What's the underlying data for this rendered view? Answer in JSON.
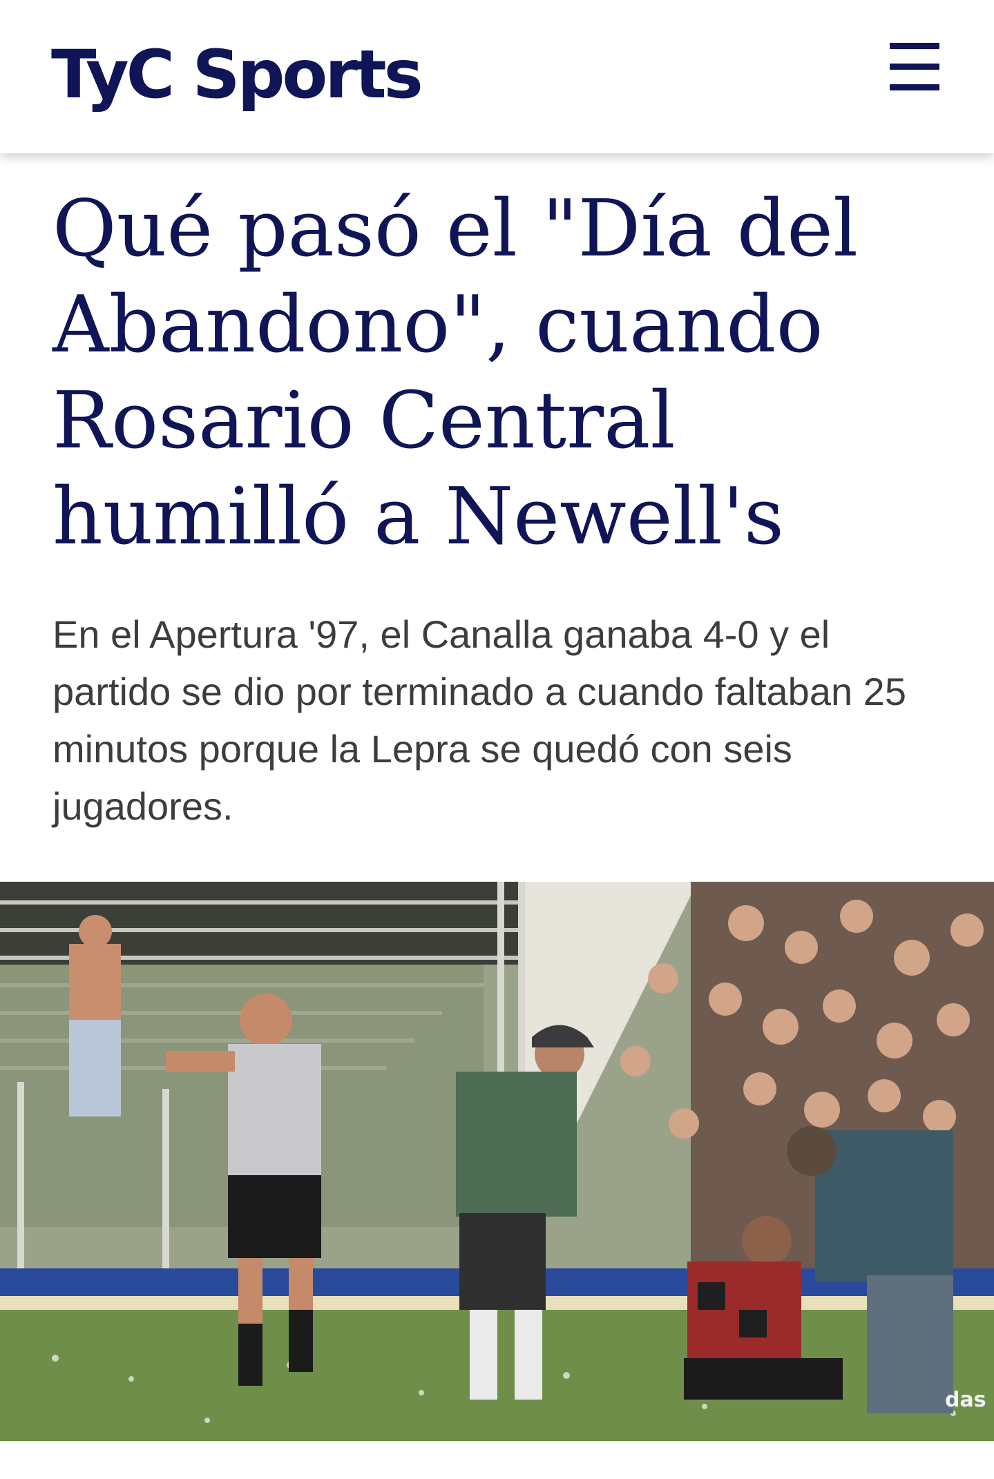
{
  "header": {
    "logo_text": "TyC Sports",
    "menu_icon": "hamburger-menu-icon",
    "brand_color": "#0f1557"
  },
  "article": {
    "headline": "Qué pasó el \"Día del Abandono\", cuando Rosario Central humilló a Newell's",
    "subtitle": "En el Apertura '97, el Canalla ganaba 4-0 y el partido se dio por terminado a cuando faltaban 25 minutos porque la Lepra se quedó con seis jugadores.",
    "photo_overlay_text": "das"
  }
}
